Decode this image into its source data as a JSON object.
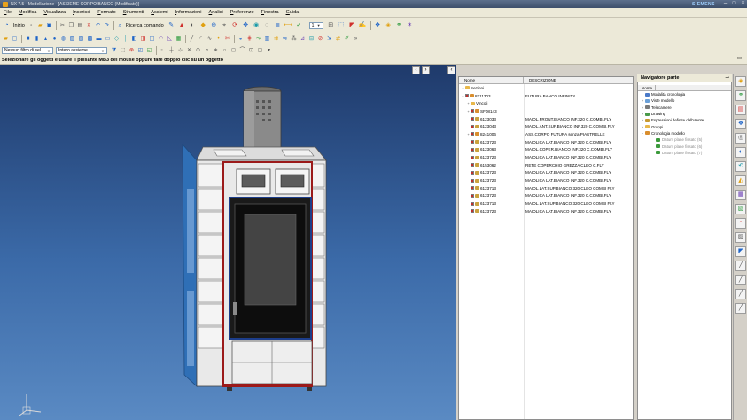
{
  "window": {
    "title": "NX 7.5 - Modellazione - [ASSIEME CORPO BANCO (Modificato)]",
    "brand": "SIEMENS",
    "controls": [
      "–",
      "□",
      "×"
    ]
  },
  "menu": {
    "items": [
      "File",
      "Modifica",
      "Visualizza",
      "Inserisci",
      "Formato",
      "Strumenti",
      "Assiemi",
      "Informazioni",
      "Analisi",
      "Preferenze",
      "Finestra",
      "Guida"
    ]
  },
  "toolbar1": {
    "start_label": "Inizio",
    "command_finder_label": "Ricerca comando",
    "zoom_value": "1"
  },
  "toolbar3": {
    "selection_filter": "Nessun filtro di sel",
    "scope_filter": "Intero assieme"
  },
  "status": {
    "cue_text": "Selezionare gli oggetti e usare il pulsante MB3 del mouse oppure fare doppio clic su un oggetto"
  },
  "part_list": {
    "columns": [
      "Nome",
      "DESCRIZIONE"
    ],
    "rows": [
      {
        "name": "Sezioni",
        "desc": "",
        "level": 0,
        "expander": "+",
        "icon": "folder",
        "checkbox": false
      },
      {
        "name": "8211303",
        "desc": "FUTURA BANCO INFINITY",
        "level": 0,
        "expander": "−",
        "icon": "asm",
        "checkbox": true
      },
      {
        "name": "Vincoli",
        "desc": "",
        "level": 1,
        "expander": "+",
        "icon": "folder",
        "checkbox": false
      },
      {
        "name": "SF08143",
        "desc": "",
        "level": 1,
        "expander": "+",
        "icon": "asm",
        "checkbox": true
      },
      {
        "name": "6123033",
        "desc": "MAIOL.FRONT.BIANCO INF.320 C.COMBI.FLY",
        "level": 1,
        "expander": "",
        "icon": "part",
        "checkbox": true
      },
      {
        "name": "6123043",
        "desc": "MAIOL.ANT.SUP.BIANCO INF.320 C.COMBI.FLY",
        "level": 1,
        "expander": "",
        "icon": "part",
        "checkbox": true
      },
      {
        "name": "8241006",
        "desc": "ASS.CORPO FUTURA senza PIASTRELLE",
        "level": 1,
        "expander": "+",
        "icon": "asm",
        "checkbox": true
      },
      {
        "name": "6123723",
        "desc": "MAIOLICA LAT.BIANCO INF.320 C.COMBI.FLY",
        "level": 1,
        "expander": "",
        "icon": "part",
        "checkbox": true
      },
      {
        "name": "6123063",
        "desc": "MAIOL.COPER.BIANCO INF.320 C.COMBI.FLY",
        "level": 1,
        "expander": "",
        "icon": "part",
        "checkbox": true
      },
      {
        "name": "6123723",
        "desc": "MAIOLICA LAT.BIANCO INF.320 C.COMBI.FLY",
        "level": 1,
        "expander": "",
        "icon": "part",
        "checkbox": true
      },
      {
        "name": "6153062",
        "desc": "RETE COPERCHIO GREZZA CLEO C.FLY",
        "level": 1,
        "expander": "",
        "icon": "part",
        "checkbox": true
      },
      {
        "name": "6123723",
        "desc": "MAIOLICA LAT.BIANCO INF.320 C.COMBI.FLY",
        "level": 1,
        "expander": "",
        "icon": "part",
        "checkbox": true
      },
      {
        "name": "6123723",
        "desc": "MAIOLICA LAT.BIANCO INF.320 C.COMBI.FLY",
        "level": 1,
        "expander": "",
        "icon": "part",
        "checkbox": true
      },
      {
        "name": "6123713",
        "desc": "MAIOL.LAT.SUP.BIANCO 320 CLEO COMBI FLY",
        "level": 1,
        "expander": "",
        "icon": "part",
        "checkbox": true
      },
      {
        "name": "6123723",
        "desc": "MAIOLICA LAT.BIANCO INF.320 C.COMBI.FLY",
        "level": 1,
        "expander": "",
        "icon": "part",
        "checkbox": true
      },
      {
        "name": "6123713",
        "desc": "MAIOL.LAT.SUP.BIANCO 320 CLEO COMBI FLY",
        "level": 1,
        "expander": "",
        "icon": "part",
        "checkbox": true
      },
      {
        "name": "6123723",
        "desc": "MAIOLICA LAT.BIANCO INF.320 C.COMBI.FLY",
        "level": 1,
        "expander": "",
        "icon": "part",
        "checkbox": true
      }
    ]
  },
  "part_navigator": {
    "title": "Navigatore parte",
    "columns": [
      "Nome",
      ""
    ],
    "rows": [
      {
        "label": "Modalità cronologia",
        "expander": "",
        "icon": "#4a7ac8",
        "grey": false
      },
      {
        "label": "Viste modello",
        "expander": "+",
        "icon": "#6aa0d8",
        "grey": false
      },
      {
        "label": "Telecamere",
        "expander": "+",
        "icon": "#7a7a7a",
        "grey": false
      },
      {
        "label": "Drawing",
        "expander": "+",
        "icon": "#4a9a4a",
        "grey": false
      },
      {
        "label": "Espressioni definite dall'utente",
        "expander": "+",
        "icon": "#c89a30",
        "grey": false
      },
      {
        "label": "Gruppi",
        "expander": "+",
        "icon": "#e8b84a",
        "grey": false
      },
      {
        "label": "Cronologia modello",
        "expander": "−",
        "icon": "#d98e2e",
        "grey": false
      },
      {
        "label": "Datum plane fissato (5)",
        "expander": "",
        "icon": "#3b9a3b",
        "grey": true
      },
      {
        "label": "Datum plane fissato (6)",
        "expander": "",
        "icon": "#3b9a3b",
        "grey": true
      },
      {
        "label": "Datum plane fissato (7)",
        "expander": "",
        "icon": "#3b9a3b",
        "grey": true
      }
    ]
  },
  "colors": {
    "viewport_top": "#1f3a6b",
    "viewport_bottom": "#5a8ac3",
    "stove_body": "#e9e9e9",
    "stove_side": "#2f6fb6",
    "glass": "#444444",
    "frame_accent": "#9b1a1a"
  }
}
